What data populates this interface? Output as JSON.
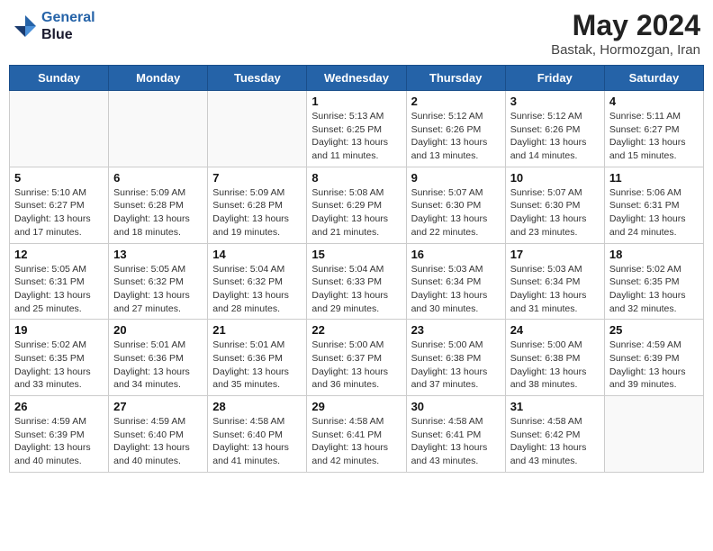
{
  "header": {
    "logo_line1": "General",
    "logo_line2": "Blue",
    "month": "May 2024",
    "location": "Bastak, Hormozgan, Iran"
  },
  "weekdays": [
    "Sunday",
    "Monday",
    "Tuesday",
    "Wednesday",
    "Thursday",
    "Friday",
    "Saturday"
  ],
  "weeks": [
    [
      {
        "day": "",
        "sunrise": "",
        "sunset": "",
        "daylight": "",
        "empty": true
      },
      {
        "day": "",
        "sunrise": "",
        "sunset": "",
        "daylight": "",
        "empty": true
      },
      {
        "day": "",
        "sunrise": "",
        "sunset": "",
        "daylight": "",
        "empty": true
      },
      {
        "day": "1",
        "sunrise": "Sunrise: 5:13 AM",
        "sunset": "Sunset: 6:25 PM",
        "daylight": "Daylight: 13 hours and 11 minutes."
      },
      {
        "day": "2",
        "sunrise": "Sunrise: 5:12 AM",
        "sunset": "Sunset: 6:26 PM",
        "daylight": "Daylight: 13 hours and 13 minutes."
      },
      {
        "day": "3",
        "sunrise": "Sunrise: 5:12 AM",
        "sunset": "Sunset: 6:26 PM",
        "daylight": "Daylight: 13 hours and 14 minutes."
      },
      {
        "day": "4",
        "sunrise": "Sunrise: 5:11 AM",
        "sunset": "Sunset: 6:27 PM",
        "daylight": "Daylight: 13 hours and 15 minutes."
      }
    ],
    [
      {
        "day": "5",
        "sunrise": "Sunrise: 5:10 AM",
        "sunset": "Sunset: 6:27 PM",
        "daylight": "Daylight: 13 hours and 17 minutes."
      },
      {
        "day": "6",
        "sunrise": "Sunrise: 5:09 AM",
        "sunset": "Sunset: 6:28 PM",
        "daylight": "Daylight: 13 hours and 18 minutes."
      },
      {
        "day": "7",
        "sunrise": "Sunrise: 5:09 AM",
        "sunset": "Sunset: 6:28 PM",
        "daylight": "Daylight: 13 hours and 19 minutes."
      },
      {
        "day": "8",
        "sunrise": "Sunrise: 5:08 AM",
        "sunset": "Sunset: 6:29 PM",
        "daylight": "Daylight: 13 hours and 21 minutes."
      },
      {
        "day": "9",
        "sunrise": "Sunrise: 5:07 AM",
        "sunset": "Sunset: 6:30 PM",
        "daylight": "Daylight: 13 hours and 22 minutes."
      },
      {
        "day": "10",
        "sunrise": "Sunrise: 5:07 AM",
        "sunset": "Sunset: 6:30 PM",
        "daylight": "Daylight: 13 hours and 23 minutes."
      },
      {
        "day": "11",
        "sunrise": "Sunrise: 5:06 AM",
        "sunset": "Sunset: 6:31 PM",
        "daylight": "Daylight: 13 hours and 24 minutes."
      }
    ],
    [
      {
        "day": "12",
        "sunrise": "Sunrise: 5:05 AM",
        "sunset": "Sunset: 6:31 PM",
        "daylight": "Daylight: 13 hours and 25 minutes."
      },
      {
        "day": "13",
        "sunrise": "Sunrise: 5:05 AM",
        "sunset": "Sunset: 6:32 PM",
        "daylight": "Daylight: 13 hours and 27 minutes."
      },
      {
        "day": "14",
        "sunrise": "Sunrise: 5:04 AM",
        "sunset": "Sunset: 6:32 PM",
        "daylight": "Daylight: 13 hours and 28 minutes."
      },
      {
        "day": "15",
        "sunrise": "Sunrise: 5:04 AM",
        "sunset": "Sunset: 6:33 PM",
        "daylight": "Daylight: 13 hours and 29 minutes."
      },
      {
        "day": "16",
        "sunrise": "Sunrise: 5:03 AM",
        "sunset": "Sunset: 6:34 PM",
        "daylight": "Daylight: 13 hours and 30 minutes."
      },
      {
        "day": "17",
        "sunrise": "Sunrise: 5:03 AM",
        "sunset": "Sunset: 6:34 PM",
        "daylight": "Daylight: 13 hours and 31 minutes."
      },
      {
        "day": "18",
        "sunrise": "Sunrise: 5:02 AM",
        "sunset": "Sunset: 6:35 PM",
        "daylight": "Daylight: 13 hours and 32 minutes."
      }
    ],
    [
      {
        "day": "19",
        "sunrise": "Sunrise: 5:02 AM",
        "sunset": "Sunset: 6:35 PM",
        "daylight": "Daylight: 13 hours and 33 minutes."
      },
      {
        "day": "20",
        "sunrise": "Sunrise: 5:01 AM",
        "sunset": "Sunset: 6:36 PM",
        "daylight": "Daylight: 13 hours and 34 minutes."
      },
      {
        "day": "21",
        "sunrise": "Sunrise: 5:01 AM",
        "sunset": "Sunset: 6:36 PM",
        "daylight": "Daylight: 13 hours and 35 minutes."
      },
      {
        "day": "22",
        "sunrise": "Sunrise: 5:00 AM",
        "sunset": "Sunset: 6:37 PM",
        "daylight": "Daylight: 13 hours and 36 minutes."
      },
      {
        "day": "23",
        "sunrise": "Sunrise: 5:00 AM",
        "sunset": "Sunset: 6:38 PM",
        "daylight": "Daylight: 13 hours and 37 minutes."
      },
      {
        "day": "24",
        "sunrise": "Sunrise: 5:00 AM",
        "sunset": "Sunset: 6:38 PM",
        "daylight": "Daylight: 13 hours and 38 minutes."
      },
      {
        "day": "25",
        "sunrise": "Sunrise: 4:59 AM",
        "sunset": "Sunset: 6:39 PM",
        "daylight": "Daylight: 13 hours and 39 minutes."
      }
    ],
    [
      {
        "day": "26",
        "sunrise": "Sunrise: 4:59 AM",
        "sunset": "Sunset: 6:39 PM",
        "daylight": "Daylight: 13 hours and 40 minutes."
      },
      {
        "day": "27",
        "sunrise": "Sunrise: 4:59 AM",
        "sunset": "Sunset: 6:40 PM",
        "daylight": "Daylight: 13 hours and 40 minutes."
      },
      {
        "day": "28",
        "sunrise": "Sunrise: 4:58 AM",
        "sunset": "Sunset: 6:40 PM",
        "daylight": "Daylight: 13 hours and 41 minutes."
      },
      {
        "day": "29",
        "sunrise": "Sunrise: 4:58 AM",
        "sunset": "Sunset: 6:41 PM",
        "daylight": "Daylight: 13 hours and 42 minutes."
      },
      {
        "day": "30",
        "sunrise": "Sunrise: 4:58 AM",
        "sunset": "Sunset: 6:41 PM",
        "daylight": "Daylight: 13 hours and 43 minutes."
      },
      {
        "day": "31",
        "sunrise": "Sunrise: 4:58 AM",
        "sunset": "Sunset: 6:42 PM",
        "daylight": "Daylight: 13 hours and 43 minutes."
      },
      {
        "day": "",
        "sunrise": "",
        "sunset": "",
        "daylight": "",
        "empty": true
      }
    ]
  ]
}
